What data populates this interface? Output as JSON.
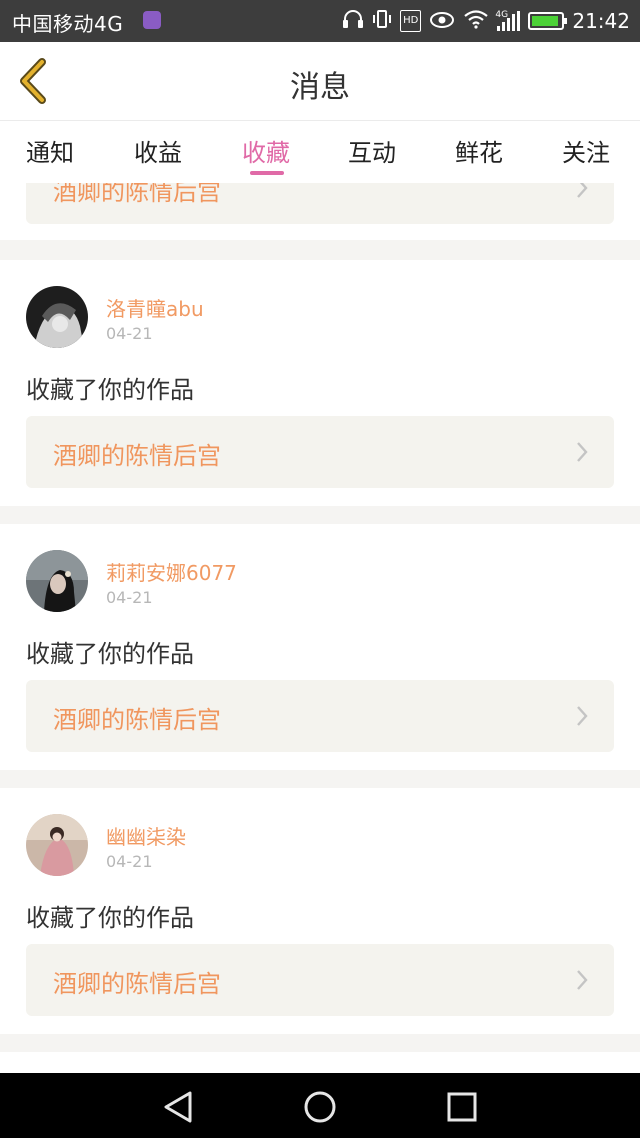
{
  "statusbar": {
    "carrier": "中国移动4G",
    "network": "4G",
    "time": "21:42",
    "hd": "HD"
  },
  "header": {
    "title": "消息"
  },
  "tabs": [
    {
      "label": "通知"
    },
    {
      "label": "收益"
    },
    {
      "label": "收藏"
    },
    {
      "label": "互动"
    },
    {
      "label": "鲜花"
    },
    {
      "label": "关注"
    }
  ],
  "active_tab": "收藏",
  "partial_card": {
    "work_title": "酒卿的陈情后宫"
  },
  "notifications": [
    {
      "username": "洛青瞳abu",
      "date": "04-21",
      "action": "收藏了你的作品",
      "work_title": "酒卿的陈情后宫"
    },
    {
      "username": "莉莉安娜6077",
      "date": "04-21",
      "action": "收藏了你的作品",
      "work_title": "酒卿的陈情后宫"
    },
    {
      "username": "幽幽柒染",
      "date": "04-21",
      "action": "收藏了你的作品",
      "work_title": "酒卿的陈情后宫"
    }
  ],
  "colors": {
    "accent": "#e06aa7",
    "username": "#f19a63",
    "work_title": "#f0965e",
    "back_arrow": "#e4b22e"
  }
}
